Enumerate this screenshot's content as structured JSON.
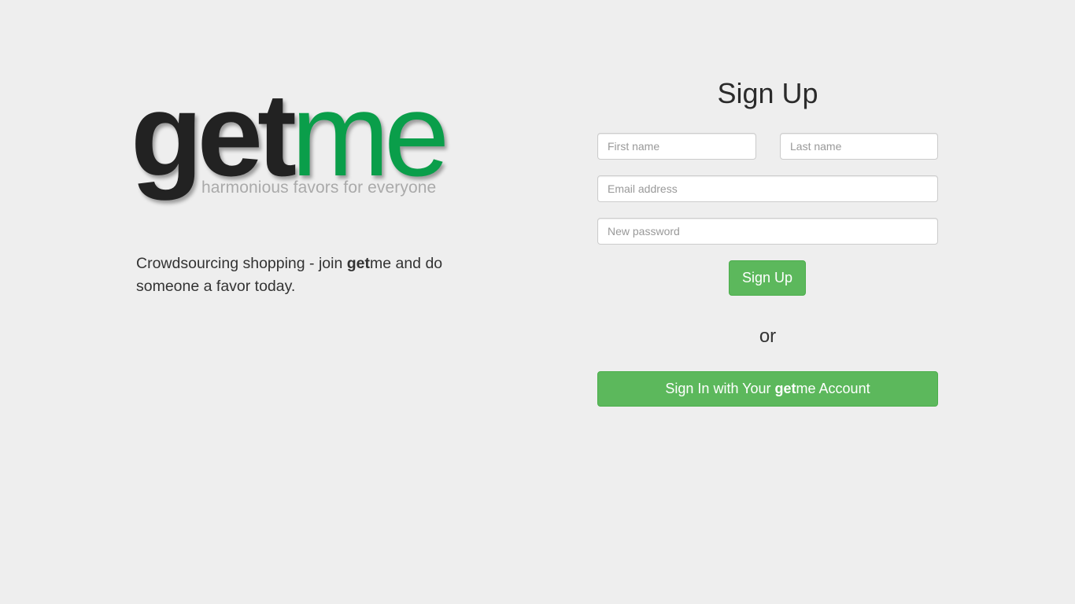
{
  "brand": {
    "logo_part1": "get",
    "logo_part2": "me",
    "tagline": "harmonious favors for everyone",
    "dark_color": "#222222",
    "accent_color": "#0a9e4a"
  },
  "description": {
    "prefix": "Crowdsourcing shopping - join ",
    "brand_bold": "get",
    "brand_rest": "me",
    "suffix": " and do someone a favor today."
  },
  "signup": {
    "title": "Sign Up",
    "first_name_placeholder": "First name",
    "last_name_placeholder": "Last name",
    "email_placeholder": "Email address",
    "password_placeholder": "New password",
    "submit_label": "Sign Up",
    "button_color": "#5cb85c"
  },
  "separator": "or",
  "signin": {
    "label_prefix": "Sign In with Your ",
    "brand_bold": "get",
    "brand_rest": "me",
    "label_suffix": " Account"
  }
}
